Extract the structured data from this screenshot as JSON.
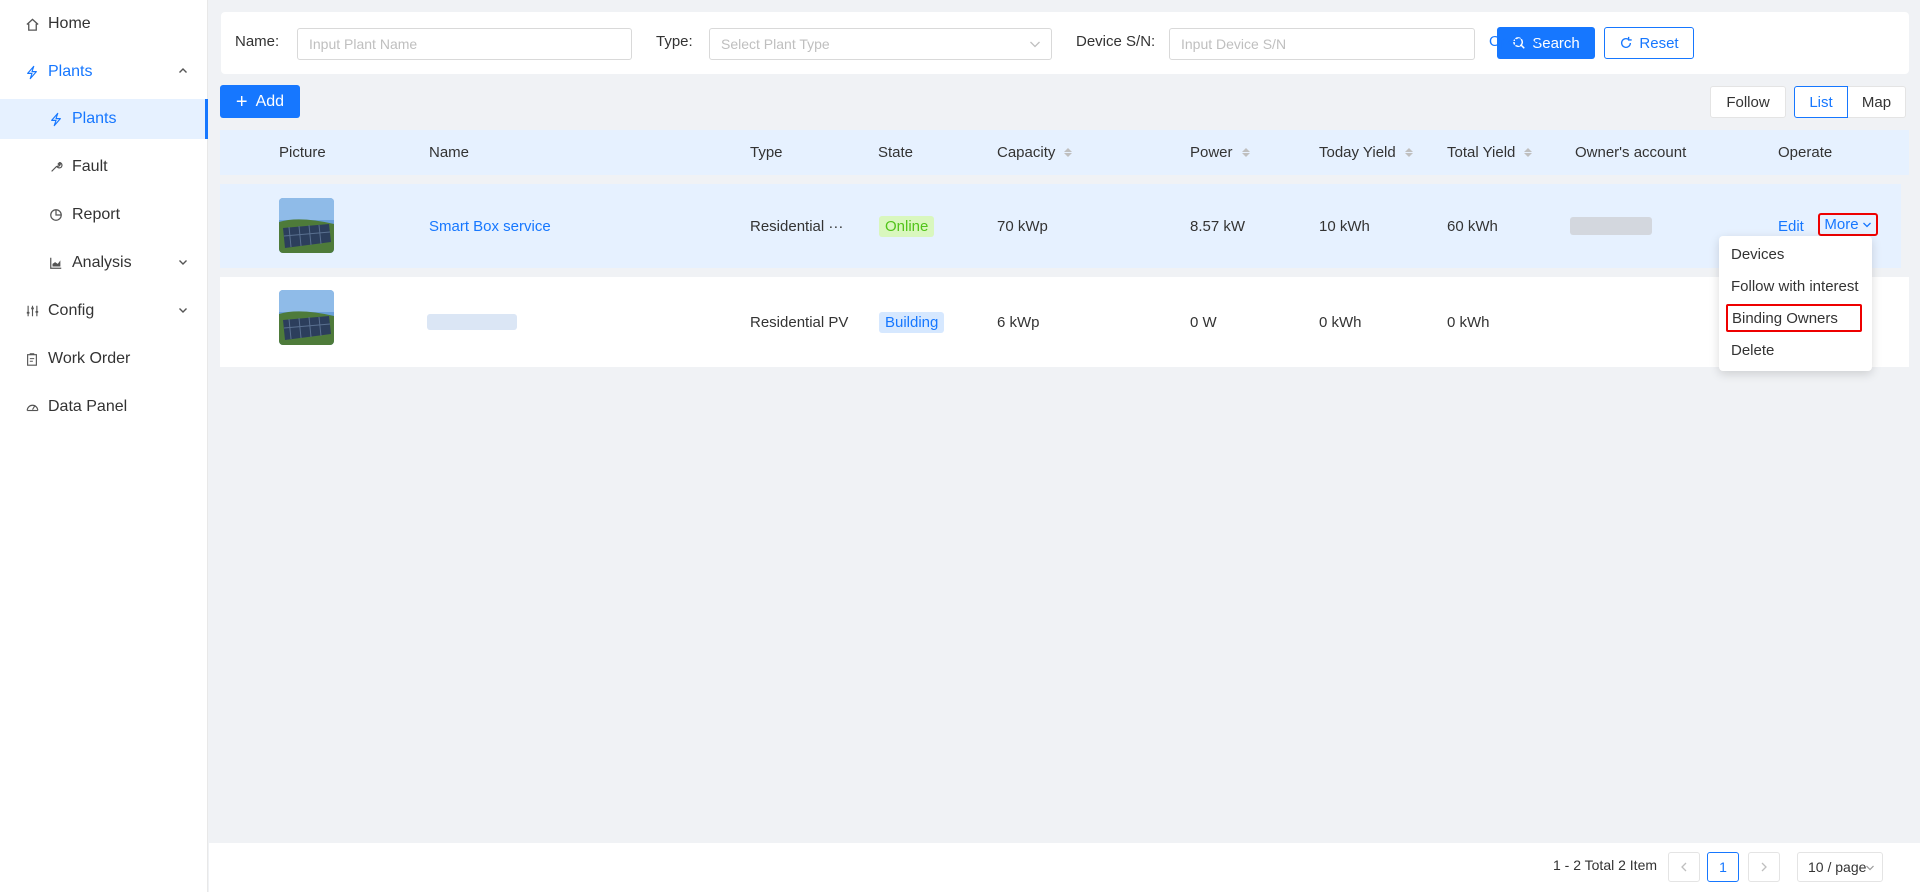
{
  "sidebar": {
    "items": [
      {
        "label": "Home",
        "icon": "home-icon"
      },
      {
        "label": "Plants",
        "icon": "bolt-icon"
      },
      {
        "label": "Plants",
        "icon": "bolt-icon"
      },
      {
        "label": "Fault",
        "icon": "wrench-icon"
      },
      {
        "label": "Report",
        "icon": "pie-icon"
      },
      {
        "label": "Analysis",
        "icon": "area-chart-icon"
      },
      {
        "label": "Config",
        "icon": "sliders-icon"
      },
      {
        "label": "Work Order",
        "icon": "clipboard-icon"
      },
      {
        "label": "Data Panel",
        "icon": "gauge-icon"
      }
    ]
  },
  "filters": {
    "name_label": "Name:",
    "name_placeholder": "Input Plant Name",
    "type_label": "Type:",
    "type_placeholder": "Select Plant Type",
    "sn_label": "Device S/N:",
    "sn_placeholder": "Input Device S/N",
    "search_label": "Search",
    "reset_label": "Reset",
    "open_label": "Open"
  },
  "toolbar": {
    "add_label": "Add",
    "follow_label": "Follow",
    "list_label": "List",
    "map_label": "Map",
    "active_view": "List"
  },
  "table": {
    "columns": [
      "Picture",
      "Name",
      "Type",
      "State",
      "Capacity",
      "Power",
      "Today Yield",
      "Total Yield",
      "Owner's account",
      "Operate"
    ],
    "rows": [
      {
        "name": "Smart Box service",
        "type": "Residential ···",
        "state": "Online",
        "capacity": "70 kWp",
        "power": "8.57 kW",
        "today_yield": "10 kWh",
        "total_yield": "60 kWh",
        "edit": "Edit",
        "more": "More"
      },
      {
        "name": "",
        "type": "Residential PV",
        "state": "Building",
        "capacity": "6 kWp",
        "power": "0 W",
        "today_yield": "0 kWh",
        "total_yield": "0 kWh"
      }
    ]
  },
  "more_menu": {
    "items": [
      "Devices",
      "Follow with interest",
      "Binding Owners",
      "Delete"
    ],
    "highlighted": "Binding Owners"
  },
  "pagination": {
    "total_text": "1 - 2 Total 2 Item",
    "current_page": "1",
    "page_size": "10 / page"
  },
  "colors": {
    "accent": "#1677ff",
    "online": "#52c41a",
    "highlight_box": "#e00000"
  }
}
